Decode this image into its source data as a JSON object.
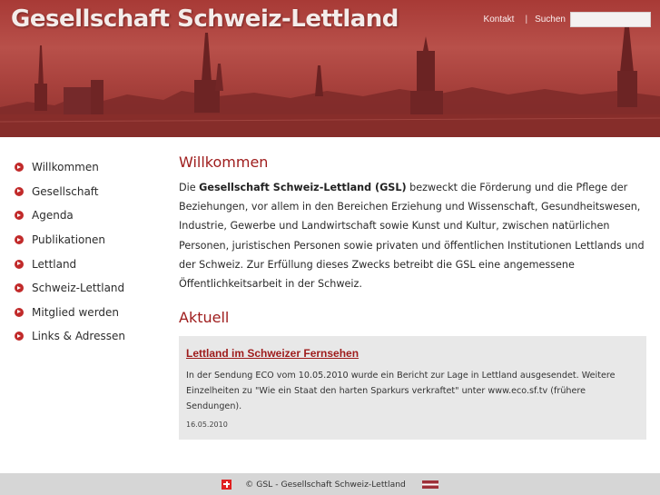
{
  "header": {
    "site_title": "Gesellschaft Schweiz-Lettland",
    "nav": {
      "kontakt": "Kontakt",
      "separator": "|",
      "search_label": "Suchen",
      "search_value": ""
    }
  },
  "sidebar": {
    "items": [
      {
        "label": "Willkommen"
      },
      {
        "label": "Gesellschaft"
      },
      {
        "label": "Agenda"
      },
      {
        "label": "Publikationen"
      },
      {
        "label": "Lettland"
      },
      {
        "label": "Schweiz-Lettland"
      },
      {
        "label": "Mitglied werden"
      },
      {
        "label": "Links & Adressen"
      }
    ]
  },
  "main": {
    "title": "Willkommen",
    "intro": {
      "prefix": "Die ",
      "bold": "Gesellschaft Schweiz-Lettland (GSL)",
      "rest": " bezweckt die Förderung und die Pflege der Beziehungen, vor allem in den Bereichen Erziehung und Wissenschaft, Gesundheitswesen, Industrie, Gewerbe und Landwirtschaft sowie Kunst und Kultur, zwischen natürlichen Personen, juristischen Personen sowie privaten und öffentlichen Institutionen Lettlands und der Schweiz. Zur Erfüllung dieses Zwecks betreibt die GSL eine angemessene Öffentlichkeitsarbeit in der Schweiz."
    },
    "news_heading": "Aktuell",
    "news": {
      "title": "Lettland im Schweizer Fernsehen",
      "text": "In der Sendung ECO vom 10.05.2010 wurde ein Bericht zur Lage in Lettland ausgesendet. Weitere Einzelheiten zu \"Wie ein Staat den harten Sparkurs verkraftet\" unter www.eco.sf.tv (frühere Sendungen).",
      "date": "16.05.2010"
    }
  },
  "footer": {
    "text": "© GSL - Gesellschaft Schweiz-Lettland"
  },
  "colors": {
    "accent": "#9e1b1b",
    "bullet": "#c12a2a",
    "header_red": "#a83a36",
    "news_bg": "#e8e8e8",
    "footer_bg": "#d6d6d6"
  },
  "icons": {
    "bullet": "arrow-bullet-icon",
    "swiss_flag": "swiss-flag-icon",
    "latvian_flag": "latvian-flag-icon"
  }
}
